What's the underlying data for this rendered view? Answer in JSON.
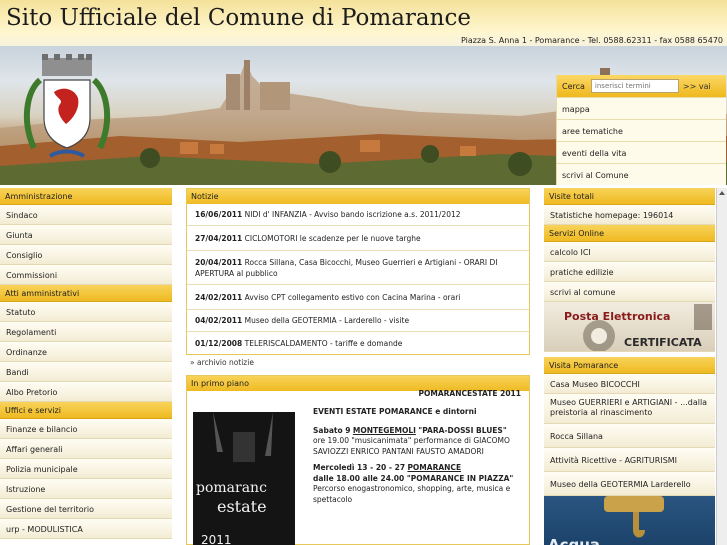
{
  "header": {
    "title": "Sito Ufficiale del Comune di Pomarance",
    "contact": "Piazza S. Anna 1 - Pomarance - Tel. 0588.62311 - fax 0588 65470"
  },
  "search": {
    "label": "Cerca",
    "placeholder": "inserisci termini",
    "go_label": ">> vai"
  },
  "quick_links": [
    "mappa",
    "aree tematiche",
    "eventi della vita",
    "scrivi al Comune"
  ],
  "left_menu": [
    {
      "heading": "Amministrazione",
      "items": [
        "Sindaco",
        "Giunta",
        "Consiglio",
        "Commissioni"
      ]
    },
    {
      "heading": "Atti amministrativi",
      "items": [
        "Statuto",
        "Regolamenti",
        "Ordinanze",
        "Bandi",
        "Albo Pretorio"
      ]
    },
    {
      "heading": "Uffici e servizi",
      "items": [
        "Finanze e bilancio",
        "Affari generali",
        "Polizia municipale",
        "Istruzione",
        "Gestione del territorio",
        "urp - MODULISTICA"
      ]
    }
  ],
  "notizie": {
    "heading": "Notizie",
    "items": [
      {
        "date": "16/06/2011",
        "text": "NIDI d' INFANZIA - Avviso bando iscrizione a.s. 2011/2012"
      },
      {
        "date": "27/04/2011",
        "text": "CICLOMOTORI le scadenze per le nuove targhe"
      },
      {
        "date": "20/04/2011",
        "text": "Rocca Sillana, Casa Bicocchi, Museo Guerrieri e Artigiani - ORARI DI APERTURA al pubblico"
      },
      {
        "date": "24/02/2011",
        "text": "Avviso CPT collegamento estivo con Cacina Marina - orari"
      },
      {
        "date": "04/02/2011",
        "text": "Museo della GEOTERMIA - Larderello - visite"
      },
      {
        "date": "01/12/2008",
        "text": "TELERISCALDAMENTO - tariffe e domande"
      }
    ],
    "archive_link": "» archivio notizie"
  },
  "primo_piano": {
    "heading": "In primo piano",
    "event_title": "POMARANCESTATE 2011",
    "subtitle": "EVENTI ESTATE POMARANCE e dintorni",
    "poster_line1": "pomaranc",
    "poster_line2": "estate",
    "poster_year": "2011",
    "events": [
      {
        "when": "Sabato 9",
        "place": "MONTEGEMOLI",
        "title": "\"PARA-DOSSI BLUES\"",
        "desc": "ore 19.00 \"musicanimata\" performance di GIACOMO SAVIOZZI ENRICO PANTANI FAUSTO AMADORI"
      },
      {
        "when": "Mercoledì 13 - 20 - 27",
        "place": "POMARANCE",
        "title": "",
        "desc_bold": "dalle 18.00 alle 24.00 \"POMARANCE IN PIAZZA\"",
        "desc": "Percorso enogastronomico, shopping, arte, musica e spettacolo"
      }
    ]
  },
  "right": {
    "visite": {
      "heading": "Visite totali",
      "items": [
        "Statistiche homepage: 196014"
      ]
    },
    "servizi": {
      "heading": "Servizi Online",
      "items": [
        "calcolo ICI",
        "pratiche edilizie",
        "scrivi al comune"
      ]
    },
    "pec": {
      "line1": "Posta Elettronica",
      "line2": "CERTIFICATA"
    },
    "visita": {
      "heading": "Visita Pomarance",
      "items": [
        "Casa Museo BICOCCHI",
        "Museo GUERRIERI e ARTIGIANI - ...dalla preistoria al rinascimento",
        "Rocca Sillana",
        "Attività Ricettive - AGRITURISMI",
        "Museo della GEOTERMIA Larderello"
      ]
    },
    "acqua": "Acqua"
  },
  "colors": {
    "accent": "#f0bd2a",
    "header_bg": "#fff6cf",
    "border": "#e6c75a"
  }
}
